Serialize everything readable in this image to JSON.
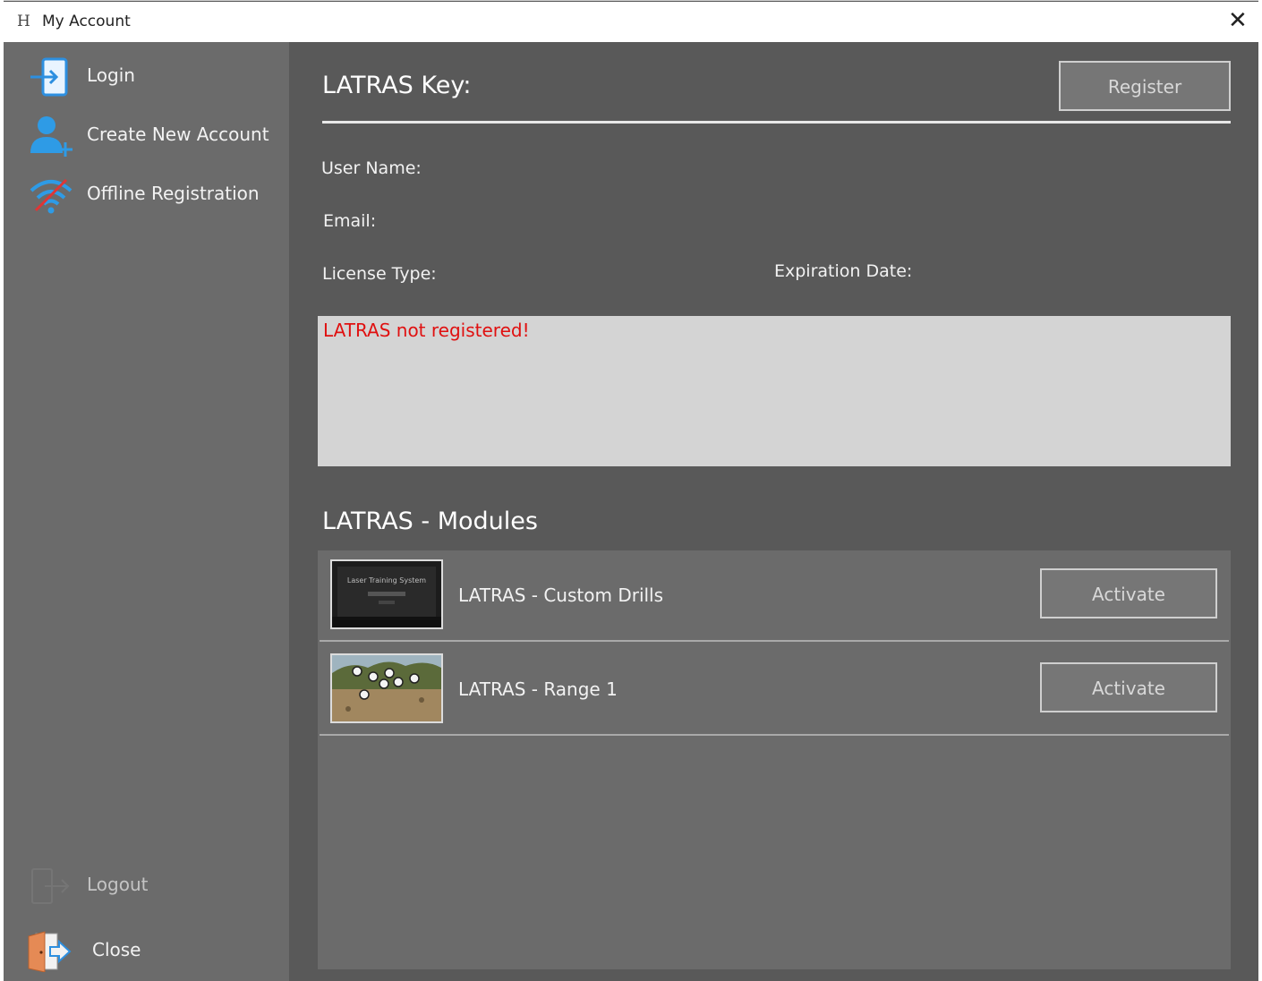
{
  "window": {
    "icon": "H",
    "title": "My Account",
    "close_glyph": "✕"
  },
  "sidebar": {
    "items": [
      {
        "label": "Login",
        "icon": "login-icon"
      },
      {
        "label": "Create New Account",
        "icon": "add-user-icon"
      },
      {
        "label": "Offline Registration",
        "icon": "wifi-icon"
      }
    ],
    "bottom_items": [
      {
        "label": "Logout",
        "icon": "logout-icon"
      },
      {
        "label": "Close",
        "icon": "exit-door-icon"
      }
    ]
  },
  "key_section": {
    "title": "LATRAS Key:",
    "register_label": "Register",
    "user_name_label": "User Name:",
    "email_label": "Email:",
    "license_type_label": "License Type:",
    "expiration_label": "Expiration Date:",
    "status_message": "LATRAS not registered!",
    "status_color": "#e01010"
  },
  "modules": {
    "title": "LATRAS - Modules",
    "items": [
      {
        "name": "LATRAS - Custom Drills",
        "thumbnail_text": "Laser Training System",
        "button": "Activate"
      },
      {
        "name": "LATRAS - Range 1",
        "button": "Activate"
      }
    ]
  }
}
